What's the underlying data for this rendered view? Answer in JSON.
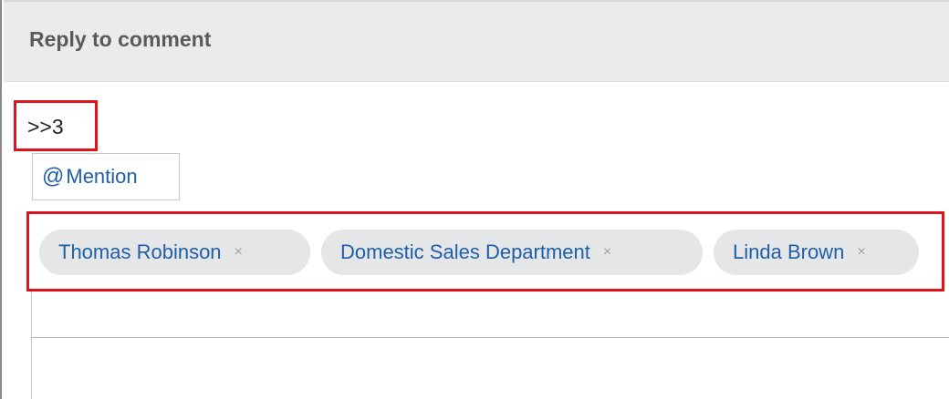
{
  "header": {
    "title": "Reply to comment"
  },
  "quote": {
    "text": ">>3"
  },
  "mention": {
    "at_symbol": "@",
    "label": "Mention"
  },
  "recipients": [
    {
      "label": "Thomas Robinson",
      "remove": "×"
    },
    {
      "label": "Domestic Sales Department",
      "remove": "×"
    },
    {
      "label": "Linda Brown",
      "remove": "×"
    }
  ],
  "colors": {
    "highlight_border": "#e0131c",
    "link_blue": "#1f5fa8",
    "tag_background": "#e4e6e8",
    "header_background": "#ebebeb"
  },
  "icons": {
    "mention": "at-sign-icon",
    "remove": "close-icon"
  }
}
